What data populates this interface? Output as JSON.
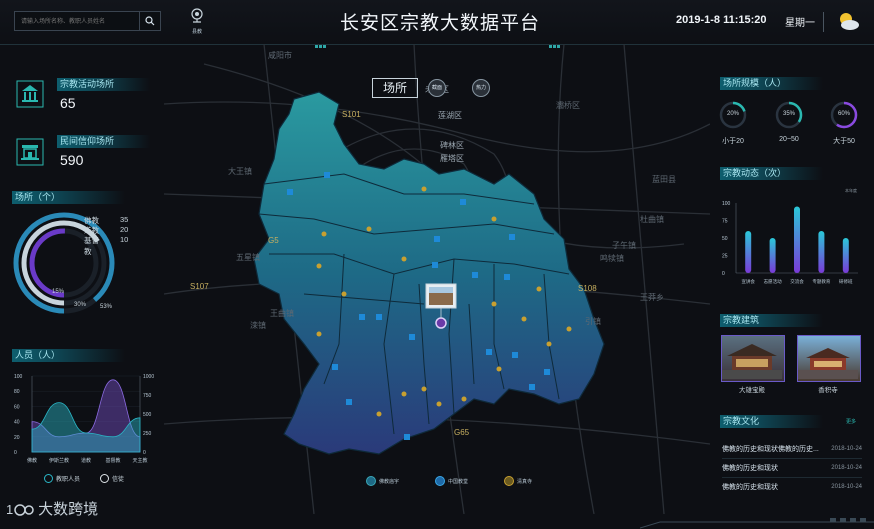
{
  "header": {
    "search_placeholder": "请输入场所名称、教职人员姓名",
    "location_label": "县教",
    "title": "长安区宗教大数据平台",
    "datetime": "2019-1-8  11:15:20",
    "weekday": "星期一",
    "weather_icon": "sun-cloud-icon"
  },
  "left": {
    "activity_places": {
      "label": "宗教活动场所",
      "value": "65"
    },
    "folk_places": {
      "label": "民间信仰场所",
      "value": "590"
    },
    "places_chart": {
      "label": "场所（个）",
      "legend": [
        {
          "name": "佛教",
          "value": "35"
        },
        {
          "name": "道教",
          "value": "20"
        },
        {
          "name": "基督教",
          "value": "10"
        }
      ],
      "pcts": [
        "15%",
        "30%",
        "53%"
      ]
    },
    "people_chart": {
      "label": "人员（人）",
      "left_ticks": [
        "100",
        "80",
        "60",
        "40",
        "20",
        "0"
      ],
      "right_ticks": [
        "1000",
        "750",
        "500",
        "250",
        "0"
      ],
      "categories": [
        "佛教",
        "伊斯兰教",
        "道教",
        "基督教",
        "天主教"
      ],
      "legend": [
        "教职人员",
        "信徒"
      ]
    }
  },
  "map": {
    "title_label": "场所",
    "btn_left": "截面",
    "btn_right": "热力",
    "road_labels": [
      "咸阳市",
      "未央区",
      "莲湖区",
      "碑林区",
      "雁塔区",
      "灞桥区",
      "G5",
      "S107",
      "S108",
      "G65",
      "S101"
    ],
    "town_labels": [
      "大王镇",
      "五星镇",
      "王曲镇",
      "滦镇",
      "子午镇",
      "鸣犊镇",
      "杜曲镇",
      "王莽乡",
      "引镇",
      "蓝田县"
    ],
    "legend": [
      "佛教庙宇",
      "中国教堂",
      "清真寺"
    ]
  },
  "right": {
    "scale": {
      "label": "场所规模（人）",
      "items": [
        {
          "pct": "20%",
          "caption": "小于20"
        },
        {
          "pct": "35%",
          "caption": "20~50"
        },
        {
          "pct": "60%",
          "caption": "大于50"
        }
      ]
    },
    "dynamics": {
      "label": "宗教动态（次）",
      "unit": "本年度",
      "yticks": [
        "100",
        "75",
        "50",
        "25",
        "0"
      ],
      "categories": [
        "宣讲会",
        "志愿活动",
        "交流会",
        "专题教育",
        "研修班"
      ]
    },
    "buildings": {
      "label": "宗教建筑",
      "items": [
        "大雄宝殿",
        "香积寺"
      ]
    },
    "culture": {
      "label": "宗教文化",
      "more": "更多",
      "items": [
        {
          "title": "佛教的历史和现状佛教的历史...",
          "date": "2018-10-24"
        },
        {
          "title": "佛教的历史和现状",
          "date": "2018-10-24"
        },
        {
          "title": "佛教的历史和现状",
          "date": "2018-10-24"
        }
      ]
    }
  },
  "footer": {
    "logo_text": "大数跨境"
  },
  "chart_data": [
    {
      "type": "pie",
      "title": "场所（个）",
      "categories": [
        "佛教",
        "道教",
        "基督教"
      ],
      "values": [
        35,
        20,
        10
      ]
    },
    {
      "type": "area",
      "title": "人员（人）",
      "categories": [
        "佛教",
        "伊斯兰教",
        "道教",
        "基督教",
        "天主教"
      ],
      "ylim": [
        0,
        100
      ],
      "y2lim": [
        0,
        1000
      ],
      "series": [
        {
          "name": "教职人员",
          "values": [
            30,
            65,
            25,
            20,
            45
          ]
        },
        {
          "name": "信徒",
          "values": [
            400,
            200,
            250,
            950,
            200
          ]
        }
      ]
    },
    {
      "type": "bar",
      "title": "宗教动态（次）",
      "categories": [
        "宣讲会",
        "志愿活动",
        "交流会",
        "专题教育",
        "研修班"
      ],
      "values": [
        60,
        50,
        95,
        60,
        50
      ],
      "ylim": [
        0,
        100
      ]
    }
  ]
}
